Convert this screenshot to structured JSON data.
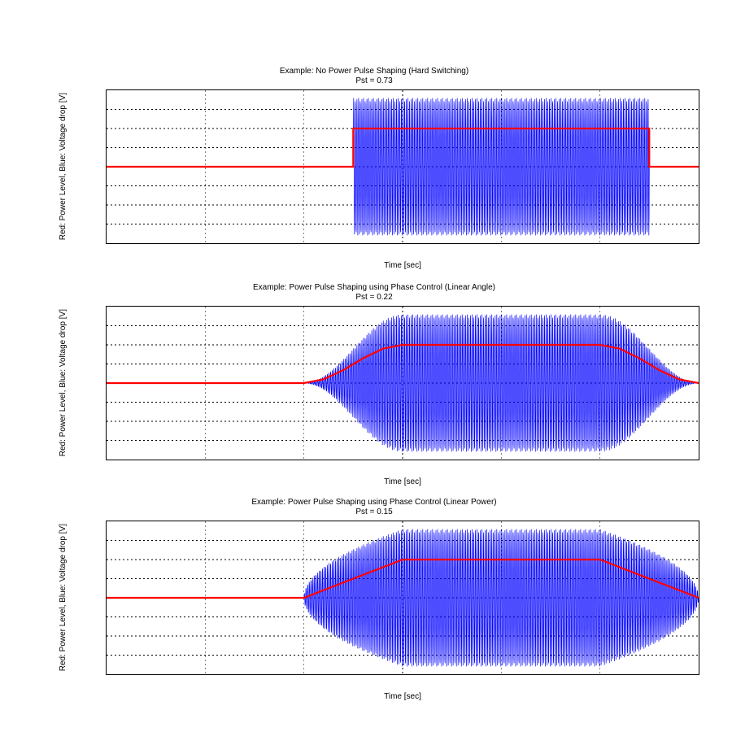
{
  "chart_data": [
    {
      "type": "line",
      "title": "Example: No Power Pulse Shaping (Hard Switching)",
      "subtitle": "Pst = 0.73",
      "xlabel": "Time [sec]",
      "ylabel": "Red: Power Level, Blue: Voltage drop [V]",
      "xlim": [
        0,
        6
      ],
      "ylim": [
        -2,
        2
      ],
      "xticks": [
        0,
        1,
        2,
        3,
        4,
        5,
        6
      ],
      "yticks": [
        -2,
        -1.5,
        -1,
        -0.5,
        0,
        0.5,
        1,
        1.5,
        2
      ],
      "grid": true,
      "colors": {
        "power": "#ff0000",
        "voltage": "#0000ff"
      },
      "series": [
        {
          "name": "Power Level",
          "shape": "step",
          "points": [
            {
              "t": 0.0,
              "v": 0
            },
            {
              "t": 2.5,
              "v": 0
            },
            {
              "t": 2.5,
              "v": 1
            },
            {
              "t": 5.5,
              "v": 1
            },
            {
              "t": 5.5,
              "v": 0
            },
            {
              "t": 6.0,
              "v": 0
            }
          ]
        },
        {
          "name": "Voltage drop",
          "shape": "sinusoid",
          "f_hz": 60,
          "segments": [
            {
              "t0": 0.0,
              "t1": 2.5,
              "amp0": 0.0,
              "amp1": 0.0
            },
            {
              "t0": 2.5,
              "t1": 5.5,
              "amp0": 1.8,
              "amp1": 1.8
            },
            {
              "t0": 5.5,
              "t1": 6.0,
              "amp0": 0.0,
              "amp1": 0.0
            }
          ]
        }
      ]
    },
    {
      "type": "line",
      "title": "Example: Power Pulse Shaping using Phase Control (Linear Angle)",
      "subtitle": "Pst = 0.22",
      "xlabel": "Time [sec]",
      "ylabel": "Red: Power Level, Blue: Voltage drop [V]",
      "xlim": [
        0,
        6
      ],
      "ylim": [
        -2,
        2
      ],
      "xticks": [
        0,
        1,
        2,
        3,
        4,
        5,
        6
      ],
      "yticks": [
        -2,
        -1.5,
        -1,
        -0.5,
        0,
        0.5,
        1,
        1.5,
        2
      ],
      "grid": true,
      "colors": {
        "power": "#ff0000",
        "voltage": "#0000ff"
      },
      "series": [
        {
          "name": "Power Level",
          "shape": "raised-cosine",
          "points": [
            {
              "t": 0.0,
              "v": 0.0
            },
            {
              "t": 2.0,
              "v": 0.0
            },
            {
              "t": 2.2,
              "v": 0.1
            },
            {
              "t": 2.4,
              "v": 0.34
            },
            {
              "t": 2.6,
              "v": 0.65
            },
            {
              "t": 2.8,
              "v": 0.9
            },
            {
              "t": 3.0,
              "v": 1.0
            },
            {
              "t": 5.0,
              "v": 1.0
            },
            {
              "t": 5.2,
              "v": 0.9
            },
            {
              "t": 5.4,
              "v": 0.65
            },
            {
              "t": 5.6,
              "v": 0.34
            },
            {
              "t": 5.8,
              "v": 0.1
            },
            {
              "t": 6.0,
              "v": 0.0
            }
          ]
        },
        {
          "name": "Voltage drop",
          "shape": "sinusoid",
          "f_hz": 60,
          "segments": [
            {
              "t0": 0.0,
              "t1": 2.0,
              "amp0": 0.0,
              "amp1": 0.0
            },
            {
              "t0": 2.0,
              "t1": 3.0,
              "amp0": 0.0,
              "amp1": 1.8,
              "easing": "raised-cosine"
            },
            {
              "t0": 3.0,
              "t1": 5.0,
              "amp0": 1.8,
              "amp1": 1.8
            },
            {
              "t0": 5.0,
              "t1": 6.0,
              "amp0": 1.8,
              "amp1": 0.0,
              "easing": "raised-cosine"
            }
          ]
        }
      ]
    },
    {
      "type": "line",
      "title": "Example: Power Pulse Shaping using Phase Control (Linear Power)",
      "subtitle": "Pst = 0.15",
      "xlabel": "Time [sec]",
      "ylabel": "Red: Power Level, Blue: Voltage drop [V]",
      "xlim": [
        0,
        6
      ],
      "ylim": [
        -2,
        2
      ],
      "xticks": [
        0,
        1,
        2,
        3,
        4,
        5,
        6
      ],
      "yticks": [
        -2,
        -1.5,
        -1,
        -0.5,
        0,
        0.5,
        1,
        1.5,
        2
      ],
      "grid": true,
      "colors": {
        "power": "#ff0000",
        "voltage": "#0000ff"
      },
      "series": [
        {
          "name": "Power Level",
          "shape": "linear-ramp",
          "points": [
            {
              "t": 0.0,
              "v": 0.0
            },
            {
              "t": 2.0,
              "v": 0.0
            },
            {
              "t": 3.0,
              "v": 1.0
            },
            {
              "t": 5.0,
              "v": 1.0
            },
            {
              "t": 6.0,
              "v": 0.0
            }
          ]
        },
        {
          "name": "Voltage drop",
          "shape": "sinusoid",
          "f_hz": 60,
          "segments": [
            {
              "t0": 0.0,
              "t1": 2.0,
              "amp0": 0.0,
              "amp1": 0.0
            },
            {
              "t0": 2.0,
              "t1": 3.0,
              "amp0": 0.0,
              "amp1": 1.8,
              "easing": "sqrt"
            },
            {
              "t0": 3.0,
              "t1": 5.0,
              "amp0": 1.8,
              "amp1": 1.8
            },
            {
              "t0": 5.0,
              "t1": 6.0,
              "amp0": 1.8,
              "amp1": 0.0,
              "easing": "sqrt"
            }
          ]
        }
      ]
    }
  ]
}
